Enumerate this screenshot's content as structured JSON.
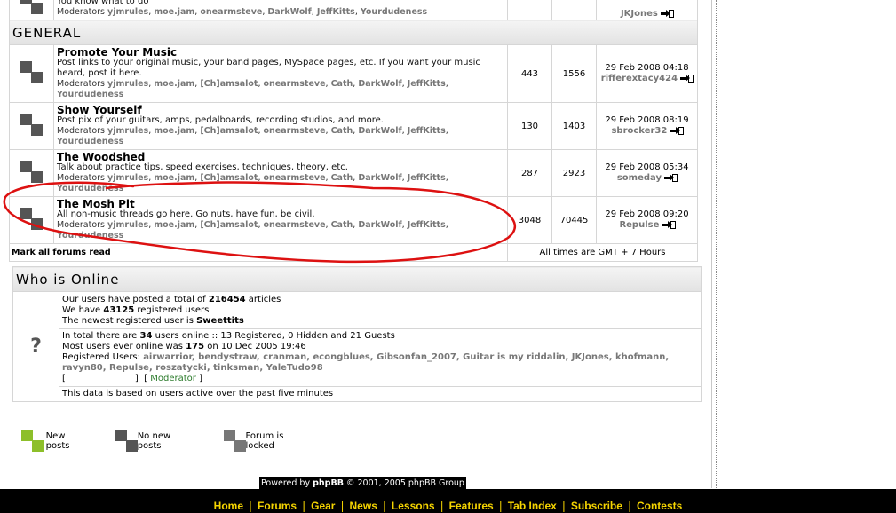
{
  "top_partial": {
    "desc": "You know what to do",
    "mods_label": "Moderators",
    "mods": [
      "yjmrules",
      "moe.jam",
      "onearmsteve",
      "DarkWolf",
      "JeffKitts",
      "Yourdudeness"
    ],
    "last_user": "JKJones"
  },
  "category": {
    "title": "GENERAL"
  },
  "forums": [
    {
      "title": "Promote Your Music",
      "desc": "Post links to your original music, your band pages, MySpace pages, etc. If you want your music heard, post it here.",
      "mods_label": "Moderators",
      "mods": [
        "yjmrules",
        "moe.jam",
        "[Ch]amsalot",
        "onearmsteve",
        "Cath",
        "DarkWolf",
        "JeffKitts",
        "Yourdudeness"
      ],
      "topics": "443",
      "posts": "1556",
      "last_date": "29 Feb 2008 04:18",
      "last_user": "rifferextacy424"
    },
    {
      "title": "Show Yourself",
      "desc": "Post pix of your guitars, amps, pedalboards, recording studios, and more.",
      "mods_label": "Moderators",
      "mods": [
        "yjmrules",
        "moe.jam",
        "[Ch]amsalot",
        "onearmsteve",
        "Cath",
        "DarkWolf",
        "JeffKitts",
        "Yourdudeness"
      ],
      "topics": "130",
      "posts": "1403",
      "last_date": "29 Feb 2008 08:19",
      "last_user": "sbrocker32"
    },
    {
      "title": "The Woodshed",
      "desc": "Talk about practice tips, speed exercises, techniques, theory, etc.",
      "mods_label": "Moderators",
      "mods": [
        "yjmrules",
        "moe.jam",
        "[Ch]amsalot",
        "onearmsteve",
        "Cath",
        "DarkWolf",
        "JeffKitts",
        "Yourdudeness"
      ],
      "topics": "287",
      "posts": "2923",
      "last_date": "29 Feb 2008 05:34",
      "last_user": "someday"
    },
    {
      "title": "The Mosh Pit",
      "desc": "All non-music threads go here. Go nuts, have fun, be civil.",
      "mods_label": "Moderators",
      "mods": [
        "yjmrules",
        "moe.jam",
        "[Ch]amsalot",
        "onearmsteve",
        "Cath",
        "DarkWolf",
        "JeffKitts",
        "Yourdudeness"
      ],
      "topics": "3048",
      "posts": "70445",
      "last_date": "29 Feb 2008 09:20",
      "last_user": "Repulse"
    }
  ],
  "footer_row": {
    "mark_read": "Mark all forums read",
    "timezone": "All times are GMT + 7 Hours"
  },
  "online": {
    "title": "Who is Online",
    "icon": "?",
    "stats": {
      "articles_pre": "Our users have posted a total of ",
      "articles": "216454",
      "articles_post": " articles",
      "users_pre": "We have ",
      "users": "43125",
      "users_post": " registered users",
      "newest_pre": "The newest registered user is ",
      "newest": "Sweettits"
    },
    "now": {
      "line1_pre": "In total there are ",
      "line1_count": "34",
      "line1_post": " users online :: 13 Registered, 0 Hidden and 21 Guests",
      "line2_pre": "Most users ever online was ",
      "line2_count": "175",
      "line2_post": " on 10 Dec 2005 19:46",
      "reg_label": "Registered Users: ",
      "reg_users": "airwarrior, bendystraw, cranman, econgblues, Gibsonfan_2007, Guitar is my riddalin, JKJones, khofmann, ravyn80, Repulse, roszatycki, tinksman, YaleTudo98",
      "legend_open": "[",
      "legend_close": "]",
      "mod_open": "[ ",
      "mod_label": "Moderator",
      "mod_close": " ]"
    },
    "footnote": "This data is based on users active over the past five minutes"
  },
  "legend": {
    "new_posts": "New posts",
    "no_new_posts": "No new posts",
    "locked": "Forum is locked"
  },
  "powered": {
    "pre": "Powered by ",
    "brand": "phpBB",
    "post": " © 2001, 2005 phpBB Group"
  },
  "nav": [
    "Home",
    "Forums",
    "Gear",
    "News",
    "Lessons",
    "Features",
    "Tab Index",
    "Subscribe",
    "Contests"
  ],
  "colors": {
    "annotation": "#dd1111",
    "nav_text": "#f5d400",
    "new_posts_icon": "#8dbf2a"
  }
}
